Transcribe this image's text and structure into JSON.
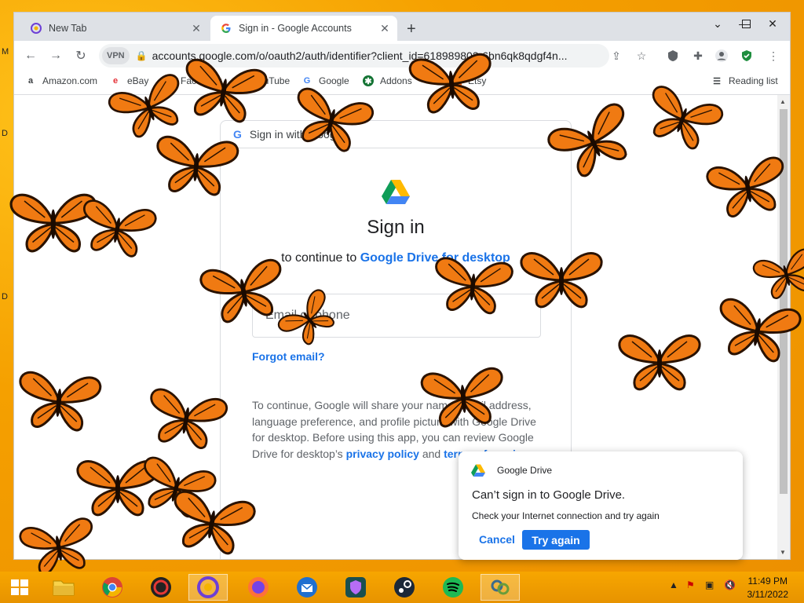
{
  "browser": {
    "tabs": [
      {
        "title": "New Tab",
        "active": false,
        "icon": "browser-logo-icon"
      },
      {
        "title": "Sign in - Google Accounts",
        "active": true,
        "icon": "google-g-icon"
      }
    ],
    "url": "accounts.google.com/o/oauth2/auth/identifier?client_id=618989803-6bn6qk8qdgf4n...",
    "vpn_label": "VPN",
    "bookmarks": [
      {
        "label": "Amazon.com",
        "icon": "amazon-icon"
      },
      {
        "label": "eBay",
        "icon": "ebay-icon"
      },
      {
        "label": "Facebook",
        "icon": "facebook-icon"
      },
      {
        "label": "YouTube",
        "icon": "youtube-icon"
      },
      {
        "label": "Google",
        "icon": "google-g-icon"
      },
      {
        "label": "Addons",
        "icon": "addons-icon"
      },
      {
        "label": "Etsy",
        "icon": "etsy-icon"
      }
    ],
    "reading_list": "Reading list"
  },
  "signin": {
    "header": "Sign in with Google",
    "title": "Sign in",
    "subtitle_prefix": "to continue to",
    "app_name": "Google Drive for desktop",
    "email_placeholder": "Email or phone",
    "forgot_email": "Forgot email?",
    "disclosure_text": "To continue, Google will share your name, email address, language preference, and profile picture with Google Drive for desktop. Before using this app, you can review Google Drive for desktop’s",
    "privacy_policy": "privacy policy",
    "and_text": "and",
    "terms": "terms of service",
    "period": "."
  },
  "notification": {
    "app": "Google Drive",
    "title": "Can’t sign in to Google Drive.",
    "body": "Check your Internet connection and try again",
    "cancel": "Cancel",
    "try_again": "Try again"
  },
  "taskbar": {
    "time": "11:49 PM",
    "date": "3/11/2022",
    "apps": [
      "start-icon",
      "file-explorer-icon",
      "chrome-icon",
      "brave-icon",
      "browser-logo-icon",
      "firefox-icon",
      "thunderbird-icon",
      "vpn-shield-icon",
      "steam-icon",
      "spotify-icon",
      "chain-app-icon"
    ]
  },
  "desktop": {
    "edge_letters": [
      "M",
      "D",
      "D"
    ]
  },
  "colors": {
    "accent": "#1a73e8",
    "taskbar": "#f2a400",
    "butterfly": "#f07a12"
  }
}
